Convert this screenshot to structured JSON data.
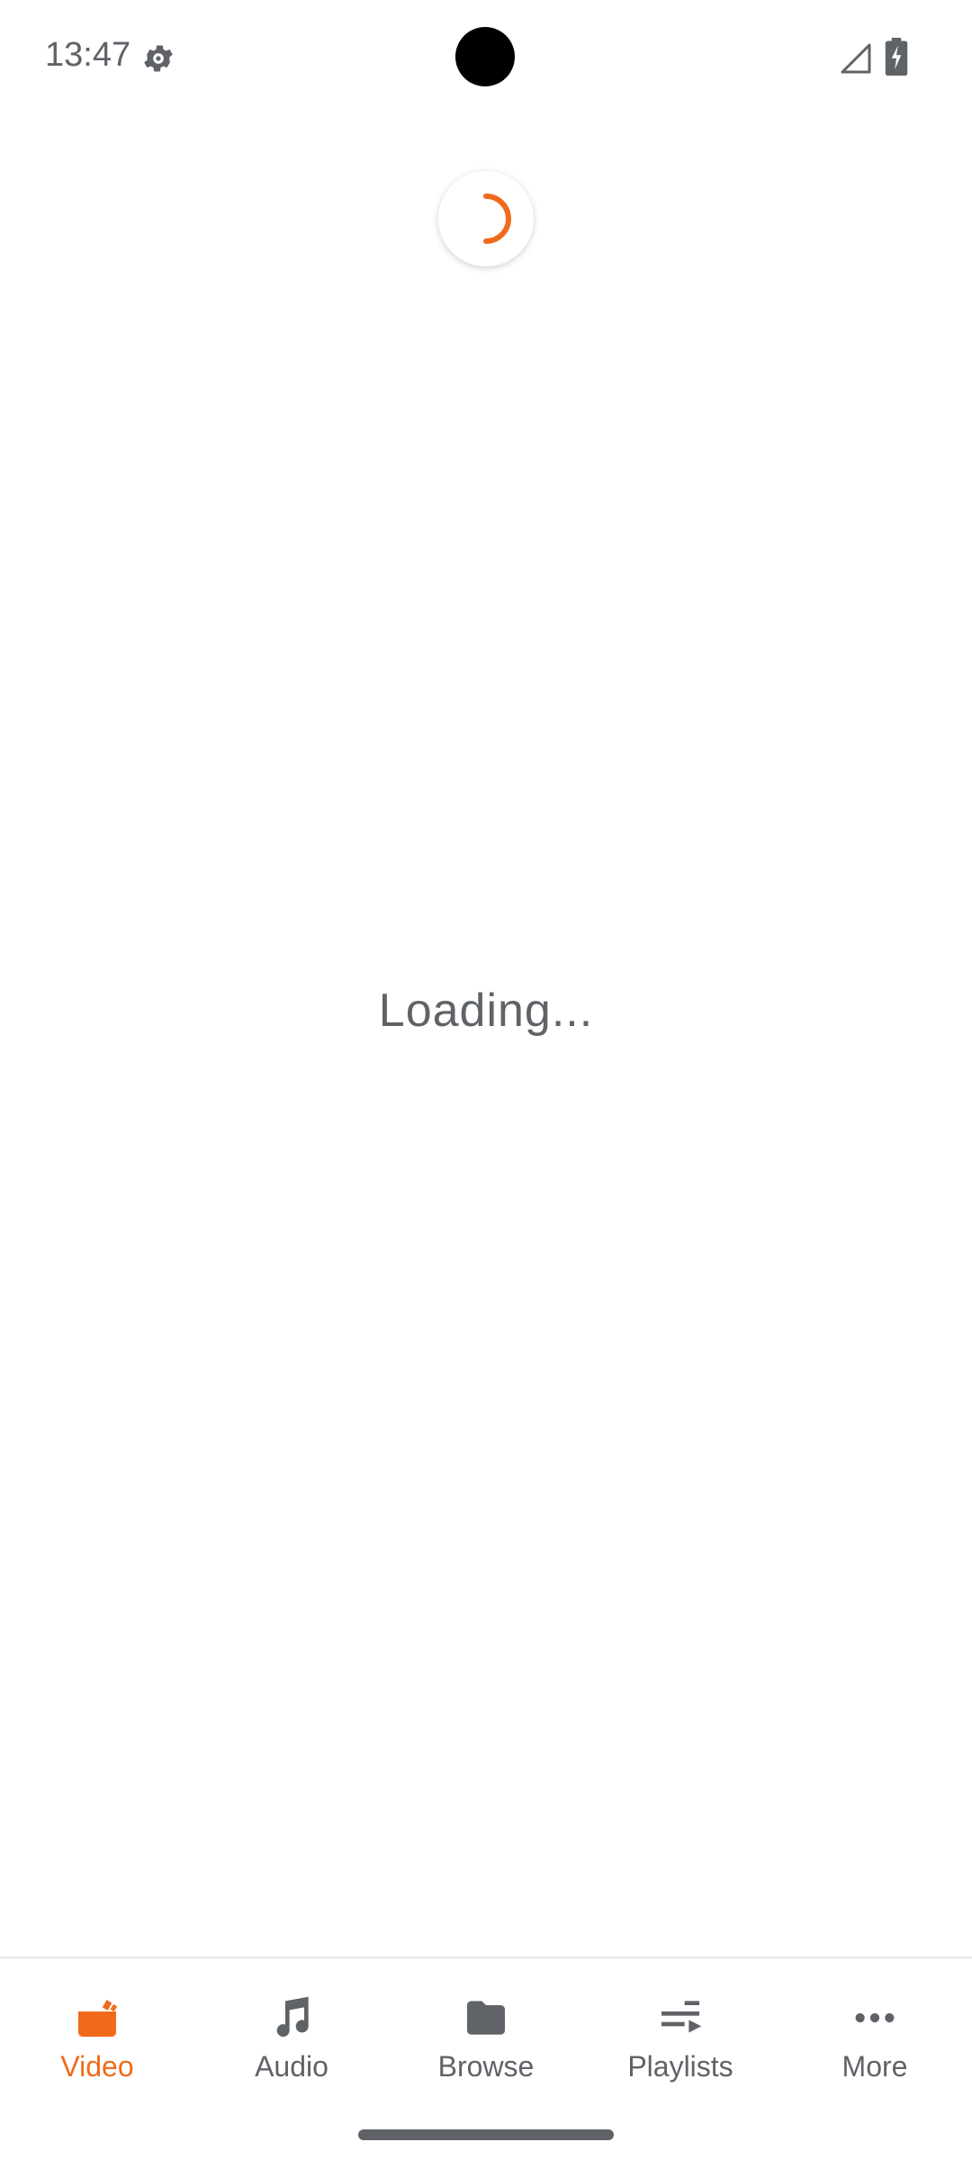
{
  "status_bar": {
    "time": "13:47",
    "icons": [
      "settings-gear-icon",
      "signal-icon",
      "battery-charging-icon"
    ]
  },
  "main": {
    "loading_text": "Loading..."
  },
  "colors": {
    "accent": "#f06a1c",
    "icon_gray": "#5f6368",
    "label_gray": "#5f6368"
  },
  "bottom_nav": {
    "items": [
      {
        "label": "Video",
        "icon": "video-clapper-icon",
        "active": true
      },
      {
        "label": "Audio",
        "icon": "music-note-icon",
        "active": false
      },
      {
        "label": "Browse",
        "icon": "folder-icon",
        "active": false
      },
      {
        "label": "Playlists",
        "icon": "playlist-icon",
        "active": false
      },
      {
        "label": "More",
        "icon": "more-horizontal-icon",
        "active": false
      }
    ]
  }
}
